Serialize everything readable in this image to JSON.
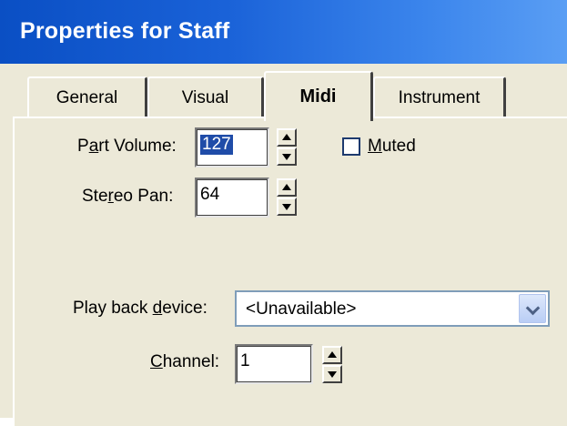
{
  "window": {
    "title": "Properties for Staff"
  },
  "tabs": [
    {
      "label": "General",
      "active": false
    },
    {
      "label": "Visual",
      "active": false
    },
    {
      "label": "Midi",
      "active": true
    },
    {
      "label": "Instrument",
      "active": false
    }
  ],
  "midi": {
    "part_volume": {
      "label_pre": "P",
      "label_mnemonic": "a",
      "label_post": "rt Volume:",
      "value": "127"
    },
    "stereo_pan": {
      "label_pre": "Ste",
      "label_mnemonic": "r",
      "label_post": "eo Pan:",
      "value": "64"
    },
    "muted": {
      "label_mnemonic": "M",
      "label_post": "uted",
      "checked": false
    },
    "playback_device": {
      "label_pre": "Play back ",
      "label_mnemonic": "d",
      "label_post": "evice:",
      "value": "<Unavailable>"
    },
    "channel": {
      "label_mnemonic": "C",
      "label_post": "hannel:",
      "value": "1"
    }
  }
}
